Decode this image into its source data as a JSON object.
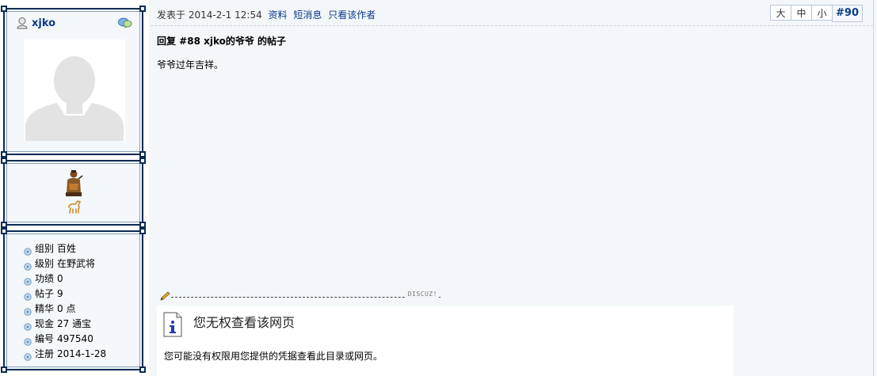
{
  "author": {
    "username": "xjko",
    "stats": [
      {
        "label": "组别",
        "value": "百姓"
      },
      {
        "label": "级别",
        "value": "在野武将"
      },
      {
        "label": "功绩",
        "value": "0"
      },
      {
        "label": "帖子",
        "value": "9"
      },
      {
        "label": "精华",
        "value": "0 点"
      },
      {
        "label": "现金",
        "value": "27 通宝"
      },
      {
        "label": "编号",
        "value": "497540"
      },
      {
        "label": "注册",
        "value": "2014-1-28"
      }
    ]
  },
  "post": {
    "meta_prefix": "发表于",
    "datetime": "2014-2-1 12:54",
    "links": {
      "profile": "资料",
      "message": "短消息",
      "only_author": "只看该作者"
    },
    "font_sizes": {
      "large": "大",
      "medium": "中",
      "small": "小"
    },
    "number": "#90",
    "title": "回复 #88 xjko的爷爷 的帖子",
    "body": "爷爷过年吉祥。"
  },
  "signature": {
    "mark": "DISCUZ!",
    "heading": "您无权查看该网页",
    "text": "您可能没有权限用您提供的凭据查看此目录或网页。"
  },
  "colors": {
    "frame_border": "#0b2a55",
    "link": "#0b3a8a",
    "content_bg": "#f3f7fa"
  },
  "icons": {
    "user": "user-icon",
    "chat": "chat-bubble-icon",
    "pencil": "pencil-icon",
    "info": "info-icon",
    "bullet": "bullet-icon"
  }
}
